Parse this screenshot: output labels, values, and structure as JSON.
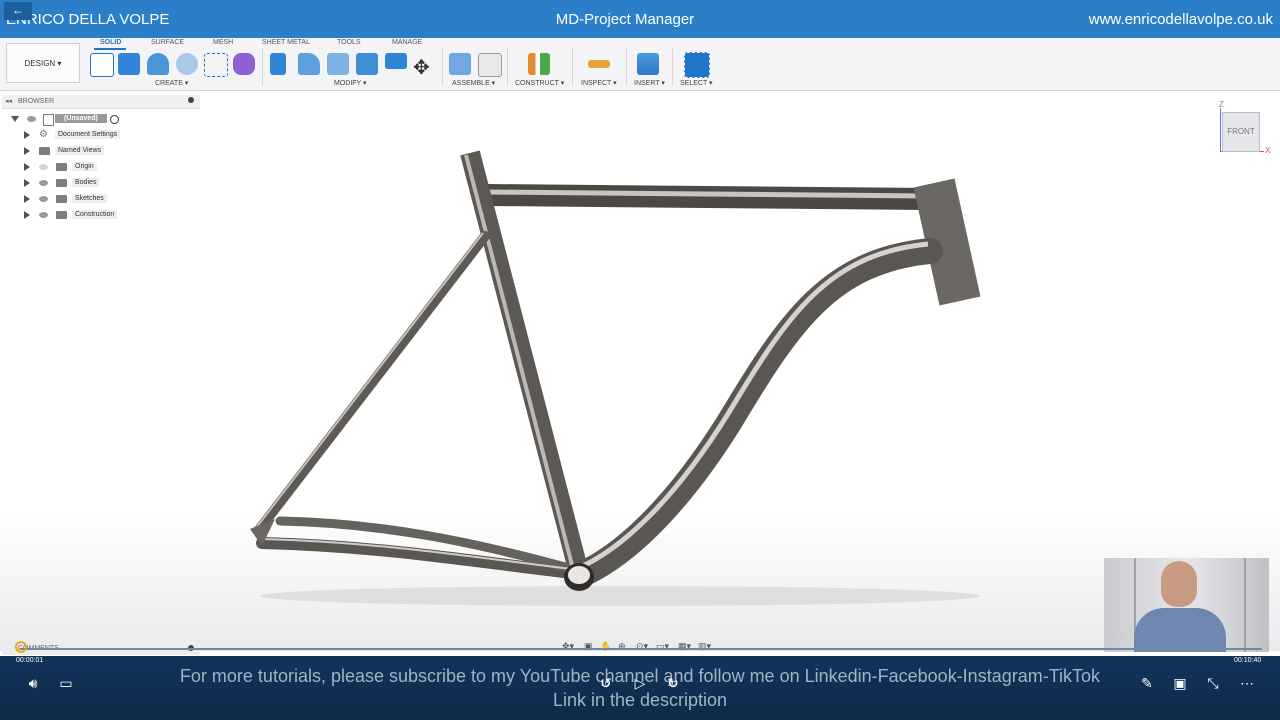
{
  "title_bar": {
    "left_text": "ENRICO DELLA VOLPE",
    "center_text": "MD-Project Manager",
    "right_text": "www.enricodellavolpe.co.uk"
  },
  "ribbon": {
    "design_label": "DESIGN ▾",
    "tabs": [
      "SOLID",
      "SURFACE",
      "MESH",
      "SHEET METAL",
      "TOOLS",
      "MANAGE"
    ],
    "groups": [
      "CREATE ▾",
      "MODIFY ▾",
      "ASSEMBLE ▾",
      "CONSTRUCT ▾",
      "INSPECT ▾",
      "INSERT ▾",
      "SELECT ▾"
    ]
  },
  "browser": {
    "title": "BROWSER",
    "root": "(Unsaved)",
    "items": [
      "Document Settings",
      "Named Views",
      "Origin",
      "Bodies",
      "Sketches",
      "Construction"
    ]
  },
  "viewcube": {
    "face": "FRONT",
    "axis_z": "Z",
    "axis_x": "X"
  },
  "comments": {
    "label": "COMMENTS"
  },
  "player": {
    "time_current": "00:00:01",
    "time_total": "00:10:40",
    "subtitle_line1": "For more tutorials, please subscribe to my YouTube channel and follow me on Linkedin-Facebook-Instagram-TikTok",
    "subtitle_line2": "Link in the description",
    "rewind_label": "10",
    "forward_label": "30",
    "progress": 0.002
  },
  "colors": {
    "title_bar": "#2b7fc9",
    "accent": "#1f76c7",
    "frame_metal": "#6e6a66",
    "player_bg": "#12345a"
  }
}
